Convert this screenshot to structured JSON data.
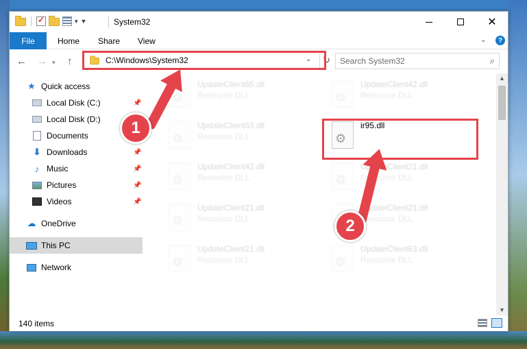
{
  "window": {
    "title": "System32",
    "status_items": "140 items"
  },
  "ribbon": {
    "tabs": [
      {
        "label": "File"
      },
      {
        "label": "Home"
      },
      {
        "label": "Share"
      },
      {
        "label": "View"
      }
    ]
  },
  "address": {
    "path": "C:\\Windows\\System32"
  },
  "search": {
    "placeholder": "Search System32"
  },
  "sidebar": {
    "items": [
      {
        "label": "Quick access",
        "icon": "star-icon"
      },
      {
        "label": "Local Disk (C:)",
        "icon": "disk-icon",
        "pinned": true
      },
      {
        "label": "Local Disk (D:)",
        "icon": "disk-icon",
        "pinned": true
      },
      {
        "label": "Documents",
        "icon": "documents-icon",
        "pinned": true
      },
      {
        "label": "Downloads",
        "icon": "downloads-icon",
        "pinned": true
      },
      {
        "label": "Music",
        "icon": "music-icon",
        "pinned": true
      },
      {
        "label": "Pictures",
        "icon": "pictures-icon",
        "pinned": true
      },
      {
        "label": "Videos",
        "icon": "videos-icon",
        "pinned": true
      },
      {
        "label": "OneDrive",
        "icon": "onedrive-icon"
      },
      {
        "label": "This PC",
        "icon": "this-pc-icon",
        "selected": true
      },
      {
        "label": "Network",
        "icon": "network-icon"
      }
    ]
  },
  "files": [
    {
      "name": "UpdateClient65.dll",
      "type": "Resource DLL",
      "faded": true
    },
    {
      "name": "UpdateClient42.dll",
      "type": "Resource DLL",
      "faded": true
    },
    {
      "name": "UpdateClient63.dll",
      "type": "Resource DLL",
      "faded": true
    },
    {
      "name": "ir95.dll",
      "type": "",
      "faded": false
    },
    {
      "name": "UpdateClient42.dll",
      "type": "Resource DLL",
      "faded": true
    },
    {
      "name": "UpdateClient21.dll",
      "type": "Resource DLL",
      "faded": true
    },
    {
      "name": "UpdateClient21.dll",
      "type": "Resource DLL",
      "faded": true
    },
    {
      "name": "UpdateClient21.dll",
      "type": "Resource DLL",
      "faded": true
    },
    {
      "name": "UpdateClient21.dll",
      "type": "Resource DLL",
      "faded": true
    },
    {
      "name": "UpdateClient63.dll",
      "type": "Resource DLL",
      "faded": true
    }
  ],
  "annotations": {
    "step1": "1",
    "step2": "2"
  },
  "colors": {
    "accent": "#1979ca",
    "highlight": "#e5434b"
  }
}
